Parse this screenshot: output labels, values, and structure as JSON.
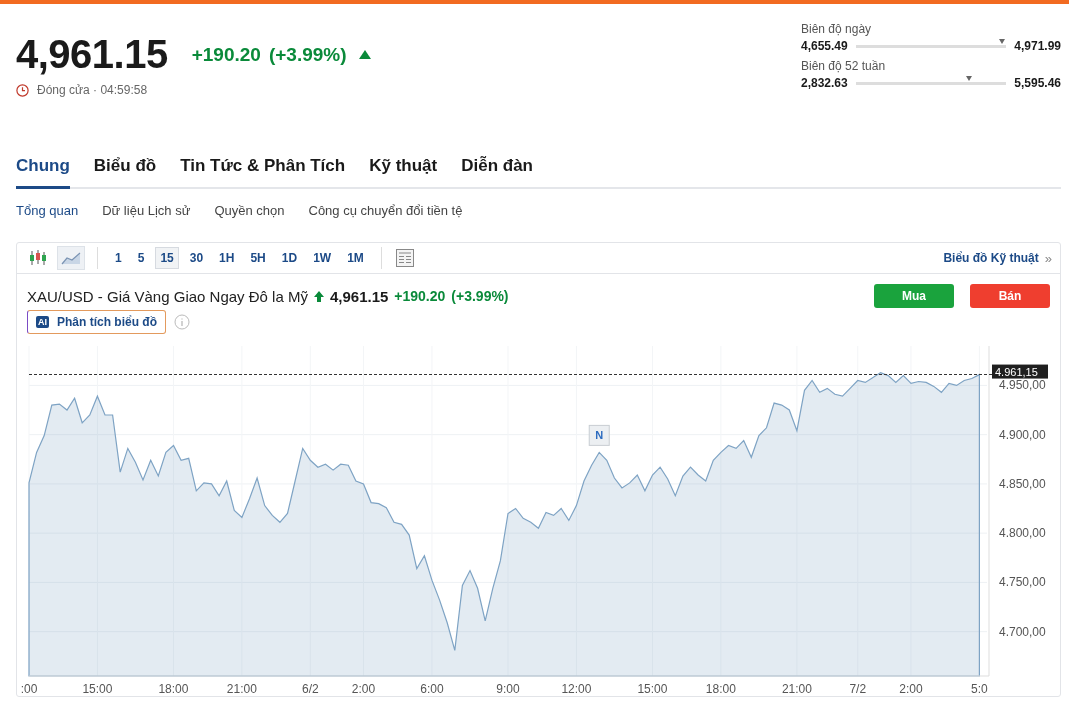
{
  "quote": {
    "price": "4,961.15",
    "change": "+190.20",
    "change_pct": "(+3.99%)",
    "status": "Đóng cửa · 04:59:58"
  },
  "ranges": [
    {
      "label": "Biên độ ngày",
      "low": "4,655.49",
      "high": "4,971.99",
      "level": 0.97
    },
    {
      "label": "Biên độ 52 tuần",
      "low": "2,832.63",
      "high": "5,595.46",
      "level": 0.75
    }
  ],
  "tabs": [
    {
      "label": "Chung",
      "selected": true
    },
    {
      "label": "Biểu đồ",
      "selected": false
    },
    {
      "label": "Tin Tức & Phân Tích",
      "selected": false
    },
    {
      "label": "Kỹ thuật",
      "selected": false
    },
    {
      "label": "Diễn đàn",
      "selected": false
    }
  ],
  "subtabs": [
    {
      "label": "Tổng quan",
      "selected": true
    },
    {
      "label": "Dữ liệu Lịch sử",
      "selected": false
    },
    {
      "label": "Quyền chọn",
      "selected": false
    },
    {
      "label": "Công cụ chuyển đổi tiền tệ",
      "selected": false
    }
  ],
  "chart_panel": {
    "chart_types": [
      {
        "kind": "candles",
        "selected": false
      },
      {
        "kind": "area",
        "selected": true
      }
    ],
    "intervals": [
      {
        "label": "1",
        "selected": false
      },
      {
        "label": "5",
        "selected": false
      },
      {
        "label": "15",
        "selected": true
      },
      {
        "label": "30",
        "selected": false
      },
      {
        "label": "1H",
        "selected": false
      },
      {
        "label": "5H",
        "selected": false
      },
      {
        "label": "1D",
        "selected": false
      },
      {
        "label": "1W",
        "selected": false
      },
      {
        "label": "1M",
        "selected": false
      }
    ],
    "tech_link": "Biểu đồ Kỹ thuật",
    "tech_link_arrow": "»",
    "instrument": "XAU/USD - Giá Vàng Giao Ngay Đô la Mỹ",
    "price": "4,961.15",
    "change": "+190.20",
    "change_pct": "(+3.99%)",
    "ai_button": "Phân tích biểu đồ",
    "ai_badge": "AI",
    "buy": "Mua",
    "sell": "Bán",
    "chart_data": {
      "type": "area",
      "ylim": [
        4655,
        4990
      ],
      "grid": true,
      "categories": [
        ":00",
        null,
        null,
        null,
        null,
        null,
        null,
        null,
        null,
        "15:00",
        null,
        null,
        null,
        null,
        null,
        null,
        null,
        null,
        null,
        "18:00",
        null,
        null,
        null,
        null,
        null,
        null,
        null,
        null,
        "21:00",
        null,
        null,
        null,
        null,
        null,
        null,
        null,
        null,
        "6/2",
        null,
        null,
        null,
        null,
        null,
        null,
        "2:00",
        null,
        null,
        null,
        null,
        null,
        null,
        null,
        null,
        "6:00",
        null,
        null,
        null,
        null,
        null,
        null,
        null,
        null,
        null,
        "9:00",
        null,
        null,
        null,
        null,
        null,
        null,
        null,
        null,
        "12:00",
        null,
        null,
        null,
        null,
        null,
        null,
        null,
        null,
        null,
        "15:00",
        null,
        null,
        null,
        null,
        null,
        null,
        null,
        null,
        "18:00",
        null,
        null,
        null,
        null,
        null,
        null,
        null,
        null,
        null,
        "21:00",
        null,
        null,
        null,
        null,
        null,
        null,
        null,
        "7/2",
        null,
        null,
        null,
        null,
        null,
        null,
        "2:00",
        null,
        null,
        null,
        null,
        null,
        null,
        null,
        null,
        "5:0"
      ],
      "yticks": [
        {
          "value": 4700,
          "label": "4.700,00"
        },
        {
          "value": 4750,
          "label": "4.750,00"
        },
        {
          "value": 4800,
          "label": "4.800,00"
        },
        {
          "value": 4850,
          "label": "4.850,00"
        },
        {
          "value": 4900,
          "label": "4.900,00"
        },
        {
          "value": 4950,
          "label": "4.950,00"
        }
      ],
      "series": [
        {
          "color": "#7ea3c4",
          "values": [
            4851,
            4882,
            4899,
            4930,
            4931,
            4925,
            4937,
            4912,
            4920,
            4939,
            4920,
            4920,
            4862,
            4886,
            4872,
            4854,
            4874,
            4858,
            4882,
            4889,
            4874,
            4876,
            4843,
            4851,
            4850,
            4838,
            4853,
            4823,
            4816,
            4835,
            4856,
            4828,
            4818,
            4811,
            4820,
            4853,
            4886,
            4874,
            4867,
            4870,
            4864,
            4870,
            4869,
            4853,
            4850,
            4831,
            4830,
            4826,
            4811,
            4809,
            4798,
            4764,
            4777,
            4752,
            4732,
            4709,
            4681,
            4747,
            4762,
            4744,
            4711,
            4744,
            4772,
            4820,
            4825,
            4815,
            4811,
            4805,
            4821,
            4818,
            4825,
            4813,
            4828,
            4853,
            4869,
            4882,
            4874,
            4856,
            4846,
            4851,
            4859,
            4843,
            4859,
            4867,
            4855,
            4838,
            4858,
            4867,
            4859,
            4853,
            4874,
            4882,
            4889,
            4886,
            4894,
            4877,
            4899,
            4907,
            4932,
            4930,
            4925,
            4904,
            4945,
            4955,
            4943,
            4947,
            4941,
            4939,
            4947,
            4955,
            4953,
            4958,
            4963,
            4960,
            4953,
            4960,
            4952,
            4954,
            4953,
            4949,
            4943,
            4952,
            4950,
            4955,
            4957,
            4961
          ]
        }
      ],
      "annotations": [
        "N"
      ]
    },
    "price_tag": "4.961,15"
  }
}
